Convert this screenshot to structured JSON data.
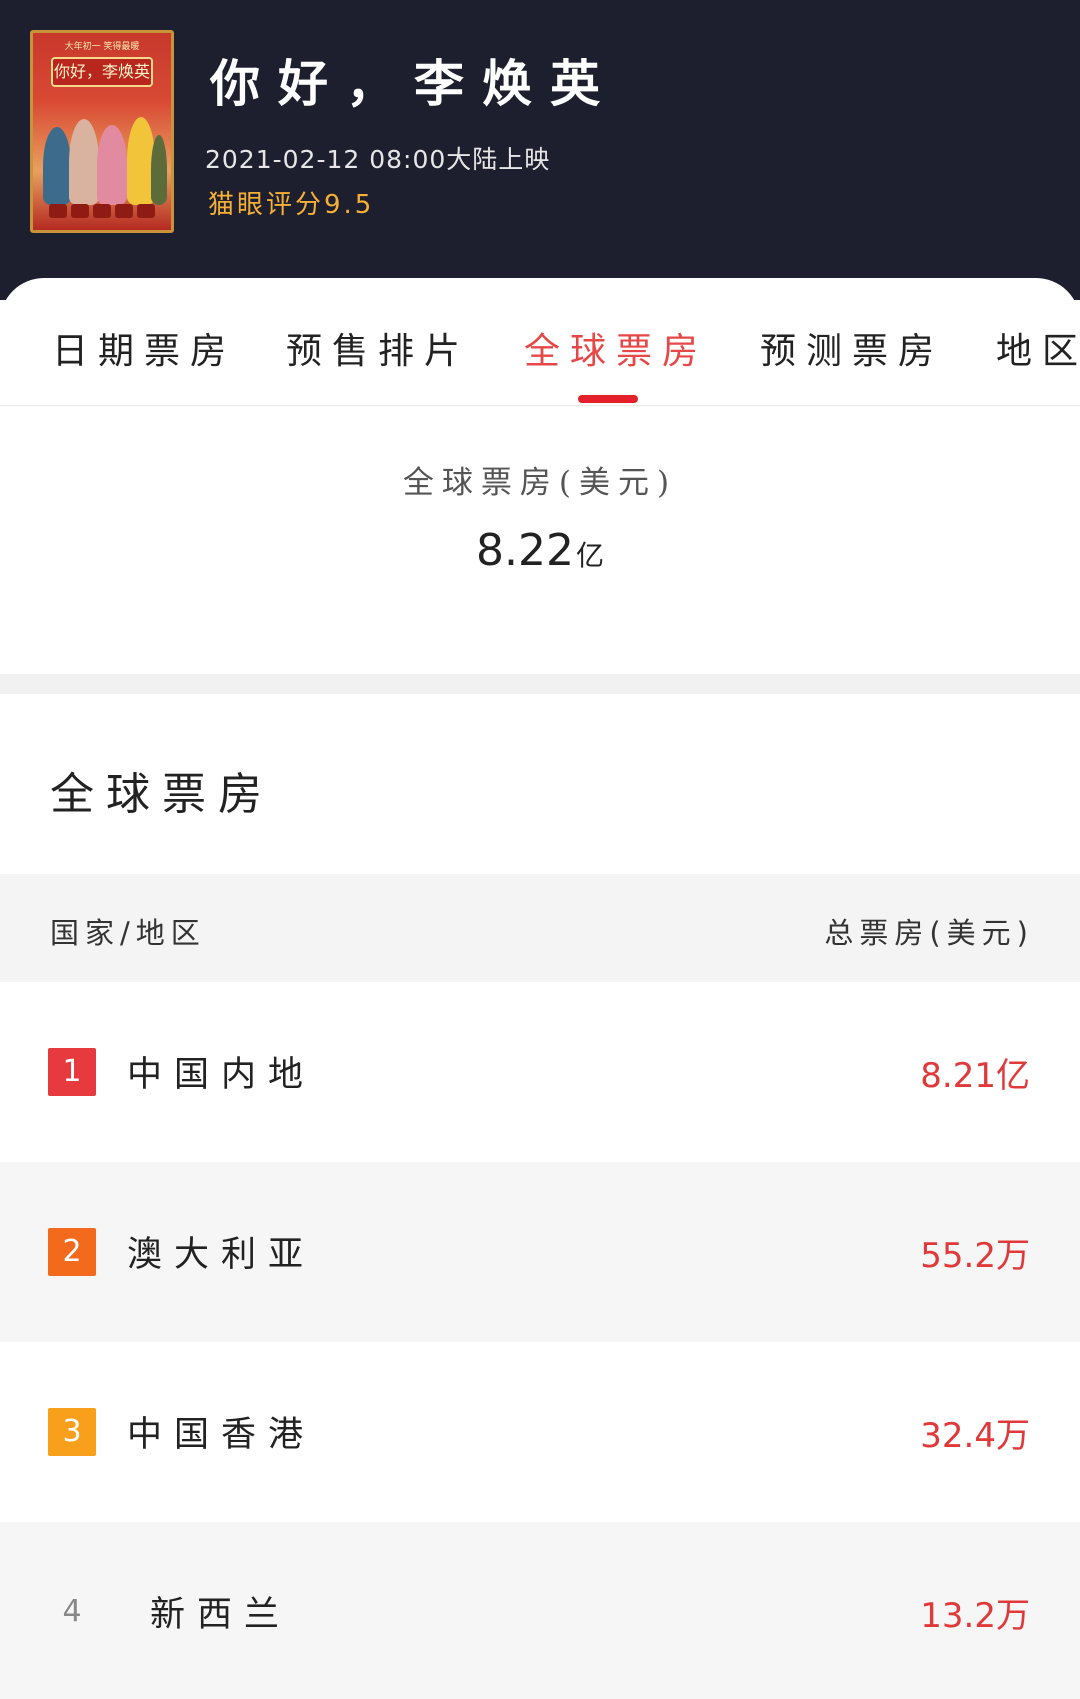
{
  "header": {
    "poster_top_text": "大年初一 笑得最暖",
    "poster_title": "你好，李焕英",
    "title": "你好，李焕英",
    "release": "2021-02-12 08:00大陆上映",
    "rating": "猫眼评分9.5"
  },
  "tabs": [
    {
      "label": "日期票房",
      "active": false
    },
    {
      "label": "预售排片",
      "active": false
    },
    {
      "label": "全球票房",
      "active": true
    },
    {
      "label": "预测票房",
      "active": false
    },
    {
      "label": "地区",
      "active": false
    }
  ],
  "summary": {
    "label": "全球票房(美元)",
    "value": "8.22",
    "unit": "亿"
  },
  "section": {
    "title": "全球票房"
  },
  "table": {
    "headers": {
      "region": "国家/地区",
      "gross": "总票房(美元)"
    },
    "rows": [
      {
        "rank": "1",
        "country": "中国内地",
        "gross": "8.21亿",
        "rank_color": "#e63a3f"
      },
      {
        "rank": "2",
        "country": "澳大利亚",
        "gross": "55.2万",
        "rank_color": "#f36a1d"
      },
      {
        "rank": "3",
        "country": "中国香港",
        "gross": "32.4万",
        "rank_color": "#f8a01b"
      },
      {
        "rank": "4",
        "country": "新西兰",
        "gross": "13.2万",
        "rank_color": ""
      }
    ]
  },
  "colors": {
    "header_bg": "#1e1f2e",
    "accent_red": "#e54846",
    "rating_gold": "#f5b035"
  }
}
